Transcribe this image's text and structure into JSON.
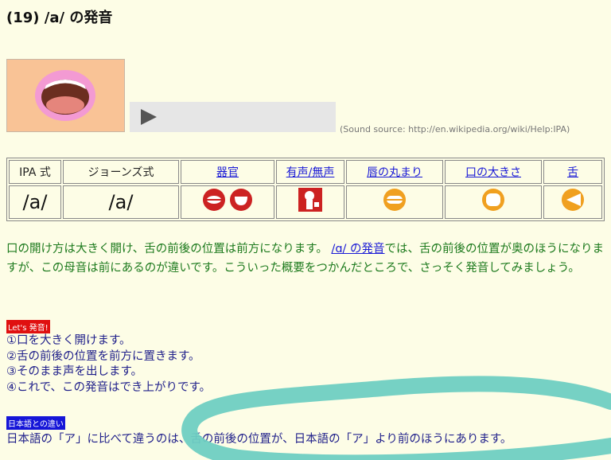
{
  "page": {
    "title": "(19) /a/ の発音"
  },
  "player": {
    "source_note": "(Sound source: http://en.wikipedia.org/wiki/Help:IPA)"
  },
  "table": {
    "headers": [
      "IPA 式",
      "ジョーンズ式",
      "器官",
      "有声/無声",
      "唇の丸まり",
      "口の大きさ",
      "舌"
    ],
    "ipa": "/a/",
    "jones": "/a/"
  },
  "description": {
    "before_link": "口の開け方は大きく開け、舌の前後の位置は前方になります。",
    "link": "/ɑ/ の発音",
    "after_link": "では、舌の前後の位置が奥のほうになりますが、この母音は前にあるのが違いです。こういった概要をつかんだところで、さっそく発音してみましょう。"
  },
  "practice": {
    "tag": "Let's 発音!",
    "steps": [
      "①口を大きく開けます。",
      "②舌の前後の位置を前方に置きます。",
      "③そのまま声を出します。",
      "④これで、この発音はでき上がりです。"
    ]
  },
  "difference": {
    "tag": "日本語との違い",
    "text": "日本語の「ア」に比べて違うのは、舌の前後の位置が、日本語の「ア」より前のほうにあります。"
  },
  "colors": {
    "highlight": "#6fcfc2",
    "link": "#1a1ad6",
    "icon_red": "#cc2222",
    "icon_orange": "#f0a020"
  }
}
